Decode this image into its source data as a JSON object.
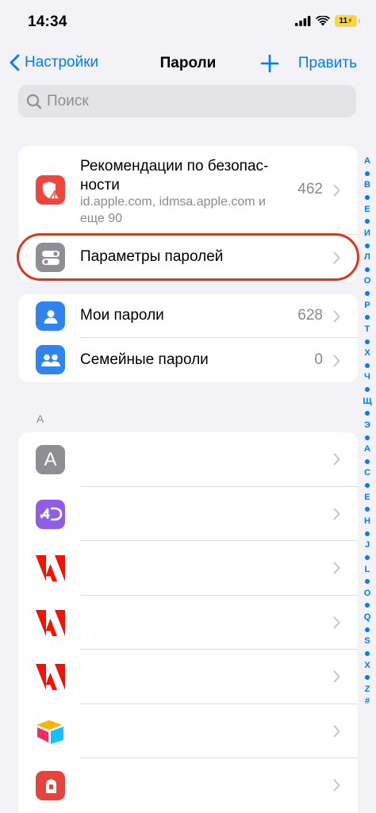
{
  "status_bar": {
    "time": "14:34",
    "battery_level": "11",
    "icons": [
      "signal-icon",
      "wifi-icon",
      "battery-icon"
    ]
  },
  "nav": {
    "back_label": "Настройки",
    "title": "Пароли",
    "add_icon": "plus-icon",
    "edit_label": "Править"
  },
  "search": {
    "placeholder": "Поиск"
  },
  "security": {
    "title": "Рекомендации по безопас-ности",
    "subtitle": "id.apple.com, idmsa.apple.com и еще 90",
    "count": "462",
    "icon": "shield-warning-icon",
    "color": "#f0453a"
  },
  "password_options": {
    "label": "Параметры паролей",
    "icon": "toggles-icon",
    "color": "#8e8e93"
  },
  "my_passwords": {
    "label": "Мои пароли",
    "count": "628",
    "icon": "person-icon",
    "color": "#2f84f0"
  },
  "family_passwords": {
    "label": "Семейные пароли",
    "count": "0",
    "icon": "people-icon",
    "color": "#2f84f0"
  },
  "section_a": {
    "header": "A"
  },
  "app_rows": [
    {
      "icon": "letter-a-icon",
      "letter": "A"
    },
    {
      "icon": "4d-icon",
      "letter": ""
    },
    {
      "icon": "adobe-icon",
      "letter": ""
    },
    {
      "icon": "adobe-icon",
      "letter": ""
    },
    {
      "icon": "adobe-icon",
      "letter": ""
    },
    {
      "icon": "airtable-icon",
      "letter": ""
    },
    {
      "icon": "red-a-app-icon",
      "letter": ""
    }
  ],
  "index_letters": [
    "А",
    "•",
    "В",
    "•",
    "Е",
    "•",
    "И",
    "•",
    "Л",
    "•",
    "О",
    "•",
    "Р",
    "•",
    "Т",
    "•",
    "Х",
    "•",
    "Ч",
    "•",
    "Щ",
    "•",
    "Э",
    "•",
    "А",
    "•",
    "С",
    "•",
    "Е",
    "•",
    "Н",
    "•",
    "J",
    "•",
    "L",
    "•",
    "O",
    "•",
    "Q",
    "•",
    "S",
    "•",
    "X",
    "•",
    "Z",
    "#"
  ],
  "colors": {
    "accent": "#007aff",
    "highlight": "#d9381e",
    "adobe_red": "#fa0f00"
  }
}
